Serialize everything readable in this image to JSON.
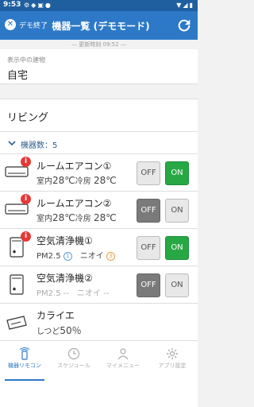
{
  "status_bar": {
    "time": "9:53"
  },
  "app_bar": {
    "exit_label": "デモ終了",
    "title": "機器一覧 (デモモード)"
  },
  "updated": "— 更新時刻 09:52 —",
  "building": {
    "label": "表示中の建物",
    "name": "自宅"
  },
  "room": {
    "name": "リビング"
  },
  "device_count": {
    "label": "機器数：5"
  },
  "devices": [
    {
      "name": "ルームエアコン①",
      "status_prefix": "室内",
      "temp_room": "28℃",
      "mode": "冷房",
      "temp_set": "28℃",
      "off_label": "OFF",
      "on_label": "ON",
      "state": "on",
      "alert": "i"
    },
    {
      "name": "ルームエアコン②",
      "status_prefix": "室内",
      "temp_room": "28℃",
      "mode": "冷房",
      "temp_set": "28℃",
      "off_label": "OFF",
      "on_label": "ON",
      "state": "off",
      "alert": "i"
    },
    {
      "name": "空気清浄機①",
      "pm_label": "PM2.5",
      "pm_value": "1",
      "odor_label": "ニオイ",
      "odor_value": "3",
      "off_label": "OFF",
      "on_label": "ON",
      "state": "on",
      "alert": "i"
    },
    {
      "name": "空気清浄機②",
      "pm_label": "PM2.5",
      "pm_value": "--",
      "odor_label": "ニオイ",
      "odor_value": "--",
      "off_label": "OFF",
      "on_label": "ON",
      "state": "off"
    },
    {
      "name": "カライエ",
      "humidity_label": "しつど",
      "humidity_value": "50％"
    }
  ],
  "tabs": [
    {
      "label": "機器リモコン",
      "icon": "remote-icon",
      "active": true
    },
    {
      "label": "スケジュール",
      "icon": "clock-icon"
    },
    {
      "label": "マイメニュー",
      "icon": "person-icon"
    },
    {
      "label": "アプリ設定",
      "icon": "gear-icon"
    }
  ],
  "colors": {
    "app_bar": "#2d79c7",
    "status_bar": "#1f5fa0",
    "on_active": "#27a844",
    "badge": "#e53935"
  }
}
